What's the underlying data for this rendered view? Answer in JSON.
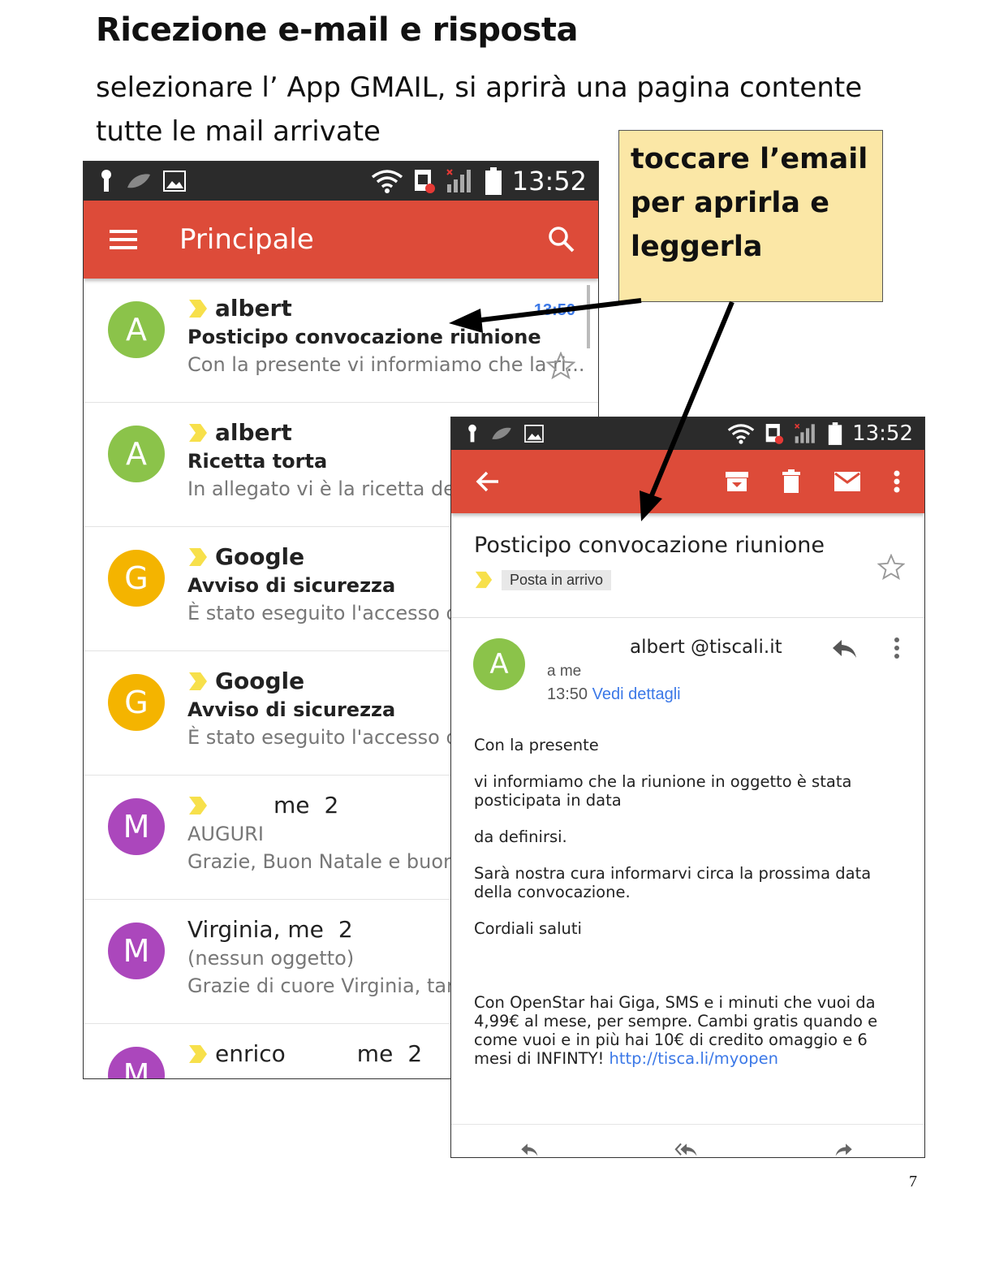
{
  "page": {
    "title": "Ricezione e-mail e risposta",
    "intro_line1": "selezionare l’ App GMAIL, si aprirà una pagina contente",
    "intro_line2": "tutte le mail arrivate",
    "page_number": "7"
  },
  "callout": {
    "line1": "toccare l’email",
    "line2": "per aprirla e",
    "line3": "leggerla"
  },
  "inbox": {
    "status_time": "13:52",
    "title": "Principale",
    "emails": [
      {
        "avatar": "A",
        "avatar_color": "#8bc34a",
        "sender": "albert",
        "subject": "Posticipo convocazione riunione",
        "snippet": "Con la presente vi informiamo che la ri...",
        "time": "13:50"
      },
      {
        "avatar": "A",
        "avatar_color": "#8bc34a",
        "sender": "albert",
        "subject": "Ricetta torta",
        "snippet": "In allegato vi è la ricetta della t"
      },
      {
        "avatar": "G",
        "avatar_color": "#f4b400",
        "sender": "Google",
        "subject": "Avviso di sicurezza",
        "snippet": "È stato eseguito l'accesso da"
      },
      {
        "avatar": "G",
        "avatar_color": "#f4b400",
        "sender": "Google",
        "subject": "Avviso di sicurezza",
        "snippet": "È stato eseguito l'accesso da"
      },
      {
        "avatar": "M",
        "avatar_color": "#ab47bc",
        "sender": "me",
        "count": "2",
        "subject": "AUGURI",
        "snippet": "Grazie, Buon Natale e buone fe"
      },
      {
        "avatar": "M",
        "avatar_color": "#ab47bc",
        "sender": "Virginia, me",
        "count": "2",
        "subject": "(nessun oggetto)",
        "snippet": "Grazie di cuore Virginia, tantiss"
      },
      {
        "avatar": "M",
        "avatar_color": "#ab47bc",
        "sender": "enrico",
        "sender2": "me",
        "count": "2",
        "subject": "",
        "snippet": ""
      }
    ]
  },
  "message": {
    "status_time": "13:52",
    "subject": "Posticipo convocazione riunione",
    "label": "Posta in arrivo",
    "avatar": "A",
    "sender": "albert @tiscali.it",
    "to": "a me",
    "time": "13:50",
    "details_link": "Vedi dettagli",
    "body": [
      "Con la presente",
      "vi informiamo che la riunione in oggetto è stata posticipata in data",
      "da definirsi.",
      "Sarà nostra cura informarvi circa la prossima data della convocazione.",
      "Cordiali saluti"
    ],
    "footer_text": "Con OpenStar hai Giga, SMS e i minuti che vuoi da 4,99€ al mese, per sempre. Cambi gratis quando e come vuoi e in più hai 10€ di credito omaggio e 6 mesi di INFINTY!",
    "footer_link": "http://tisca.li/myopen"
  },
  "colors": {
    "gmail_red": "#dd4b39",
    "callout_bg": "#fbe7a6",
    "link_blue": "#3b78e7",
    "important_marker": "#f7e04b"
  },
  "icons": [
    "menu-icon",
    "search-icon",
    "back-arrow-icon",
    "archive-icon",
    "trash-icon",
    "mail-icon",
    "more-vert-icon",
    "reply-icon",
    "reply-all-icon",
    "forward-icon",
    "star-icon",
    "important-marker-icon"
  ]
}
